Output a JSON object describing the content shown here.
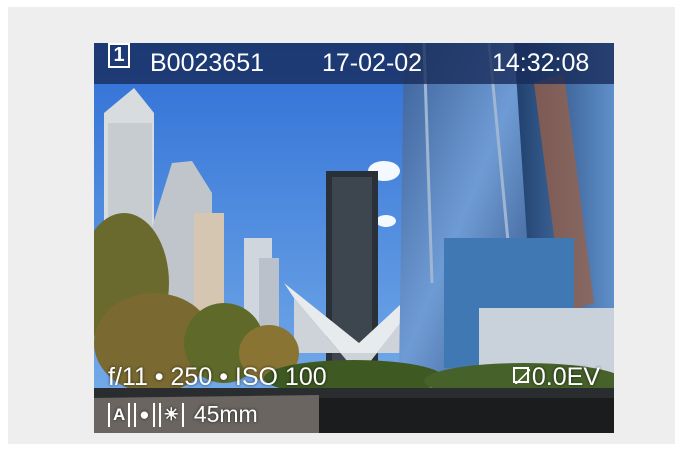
{
  "header": {
    "card_slot": "1",
    "file_name": "B0023651",
    "date": "17-02-02",
    "time": "14:32:08"
  },
  "exposure": {
    "aperture": "f/11",
    "separator": "•",
    "shutter": "250",
    "iso": "ISO 100",
    "ev_compensation": "0.0EV"
  },
  "status": {
    "mode": "A",
    "metering": "●",
    "white_balance": "☀",
    "focal_length": "45mm"
  },
  "icons": [
    "card-slot-icon",
    "ev-compensation-icon",
    "mode-a-icon",
    "metering-spot-icon",
    "white-balance-daylight-icon"
  ]
}
